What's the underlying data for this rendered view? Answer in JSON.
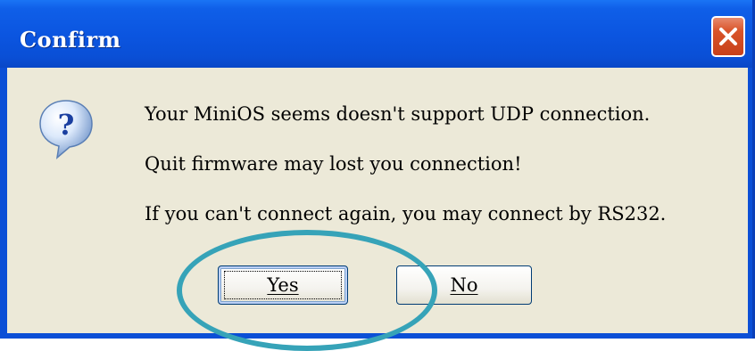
{
  "dialog": {
    "title": "Confirm",
    "icon": "question-icon",
    "messages": [
      "Your MiniOS seems doesn't support UDP connection.",
      "Quit firmware may lost you connection!",
      "If you can't connect again, you may connect by RS232."
    ],
    "buttons": {
      "yes_label": "Yes",
      "no_label": "No"
    },
    "colors": {
      "titlebar": "#0b55e0",
      "client": "#ece9d8",
      "close_button": "#d9542a",
      "annotation": "#36a3b8"
    }
  }
}
